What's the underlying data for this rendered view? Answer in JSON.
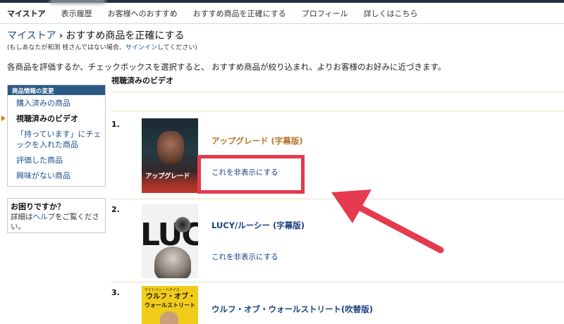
{
  "nav": {
    "items": [
      "マイストア",
      "表示履歴",
      "お客様へのおすすめ",
      "おすすめ商品を正確にする",
      "プロフィール",
      "詳しくはこちら"
    ]
  },
  "breadcrumb": {
    "link": "マイストア",
    "separator": "›",
    "current": "おすすめ商品を正確にする"
  },
  "signin_note": {
    "before": "(もしあなたが和渕 桂さんではない場合、",
    "link": "サインイン",
    "after": "してください)"
  },
  "instructions": "各商品を評価するか、チェックボックスを選択すると、 おすすめ商品が絞り込まれ、よりお客様のお好みに近づきます。",
  "sidebar": {
    "header": "商品情報の変更",
    "items": [
      "購入済みの商品",
      "視聴済みのビデオ",
      "「持っています」にチェ",
      "ックを入れた商品",
      "評価した商品",
      "興味がない商品"
    ]
  },
  "help": {
    "title": "お困りですか？",
    "before": "詳細は",
    "link": "ヘルプ",
    "after": "をご覧くださ",
    "line2": "い。"
  },
  "section_title": "視聴済みのビデオ",
  "items": [
    {
      "number": "1.",
      "title": "アップグレード (字幕版)",
      "hide_label": "これを非表示にする",
      "poster_title": "アップグレード",
      "title_color": "#b4752a"
    },
    {
      "number": "2.",
      "title": "LUCY/ルーシー (字幕版)",
      "hide_label": "これを非表示にする",
      "poster_title": "LUCY",
      "title_color": "#1a3f82"
    },
    {
      "number": "3.",
      "title": "ウルフ・オブ・ウォールストリート(吹替版)",
      "poster_small": "ケイトリン・ヘデイス",
      "poster_line1": "ウルフ・オブ・",
      "poster_line2": "ウォールストリート",
      "title_color": "#1a3f82"
    }
  ],
  "colors": {
    "link": "#1a4f8b",
    "sidebar_header": "#2b5a86",
    "highlight": "#e53a4f",
    "top_strip": "#232f3e",
    "rule": "#e5e0c8"
  },
  "icons": [
    "caret-right-icon",
    "arrow-annotation-icon"
  ]
}
